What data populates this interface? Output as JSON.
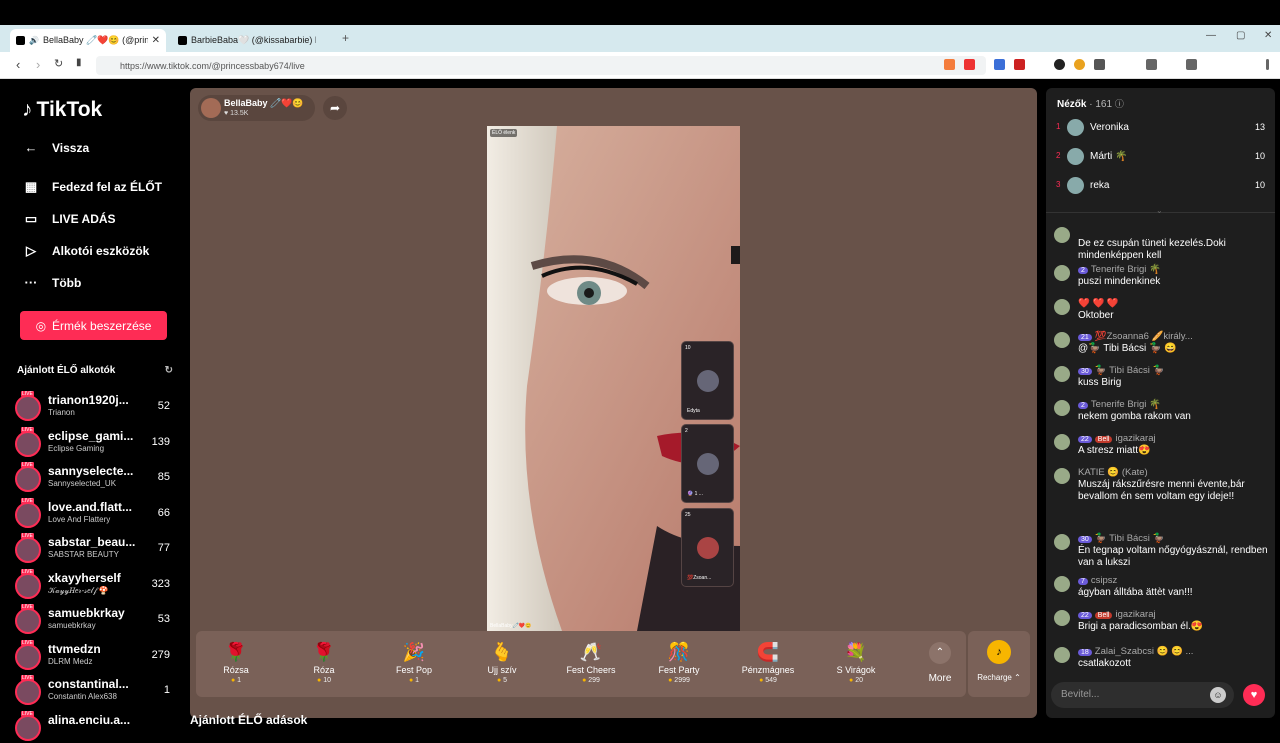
{
  "browser": {
    "tabs": [
      {
        "label": "BellaBaby 🧷❤️😊 (@princ"
      },
      {
        "label": "BarbieBaba🤍 (@kissabarbie) ÉLŐ ad"
      }
    ],
    "url": "https://www.tiktok.com/@princessbaby674/live"
  },
  "sidebar": {
    "logo": "TikTok",
    "nav": [
      {
        "label": "Vissza",
        "icon": "arrow-left"
      },
      {
        "label": "Fedezd fel az ÉLŐT",
        "icon": "calendar"
      },
      {
        "label": "LIVE ADÁS",
        "icon": "video-camera"
      },
      {
        "label": "Alkotói eszközök",
        "icon": "play-bubble"
      },
      {
        "label": "Több",
        "icon": "more"
      }
    ],
    "coins_button": "Érmék beszerzése",
    "suggested_header": "Ajánlott ÉLŐ alkotók",
    "suggested": [
      {
        "name": "trianon1920j...",
        "sub": "Trianon",
        "count": "52"
      },
      {
        "name": "eclipse_gami...",
        "sub": "Eclipse Gaming",
        "count": "139"
      },
      {
        "name": "sannyselecte...",
        "sub": "Sannyselected_UK",
        "count": "85"
      },
      {
        "name": "love.and.flatt...",
        "sub": "Love And Flattery",
        "count": "66"
      },
      {
        "name": "sabstar_beau...",
        "sub": "SABSTAR BEAUTY",
        "count": "77"
      },
      {
        "name": "xkayyherself",
        "sub": "𝒦𝒶𝓎𝓎𝐻𝑒𝓇-𝓈𝑒𝓁𝒻 🍄",
        "count": "323"
      },
      {
        "name": "samuebkrkay",
        "sub": "samuebkrkay",
        "count": "53"
      },
      {
        "name": "ttvmedzn",
        "sub": "DLRM Medz",
        "count": "279"
      },
      {
        "name": "constantinal...",
        "sub": "Constantin Alex638",
        "count": "1"
      },
      {
        "name": "alina.enciu.a...",
        "sub": "",
        "count": ""
      }
    ],
    "live_tag": "LIVE"
  },
  "stream": {
    "host_name": "BellaBaby 🧷❤️😊",
    "host_likes": "♥ 13.5K",
    "live_tag": "ÉLŐ élenk",
    "video_host_tag": "BellaBaby🧷❤️😊",
    "guests": [
      {
        "count": "10",
        "name": "Edyta"
      },
      {
        "count": "2",
        "name": "🔮 1 ..."
      },
      {
        "count": "25",
        "name": "💯Zsoan..."
      }
    ]
  },
  "gifts": [
    {
      "name": "Rózsa",
      "price": "1",
      "icon": "🌹"
    },
    {
      "name": "Róza",
      "price": "10",
      "icon": "🌹"
    },
    {
      "name": "Fest Pop",
      "price": "1",
      "icon": "🎉"
    },
    {
      "name": "Ujj szív",
      "price": "5",
      "icon": "🫰"
    },
    {
      "name": "Fest Cheers",
      "price": "299",
      "icon": "🥂"
    },
    {
      "name": "Fest Party",
      "price": "2999",
      "icon": "🎊"
    },
    {
      "name": "Pénzmágnes",
      "price": "549",
      "icon": "🧲"
    },
    {
      "name": "S Virágok",
      "price": "20",
      "icon": "💐"
    }
  ],
  "more_label": "More",
  "recharge_label": "Recharge ⌃",
  "below_title": "Ajánlott ÉLŐ adások",
  "viewers": {
    "title": "Nézők",
    "count": "· 161",
    "top": [
      {
        "rank": "1",
        "name": "Veronika",
        "score": "13"
      },
      {
        "rank": "2",
        "name": "Márti 🌴",
        "score": "10"
      },
      {
        "rank": "3",
        "name": "reka",
        "score": "10"
      }
    ]
  },
  "chat": [
    {
      "badge": "",
      "badge2": "",
      "user": "",
      "text": "De ez csupán tüneti kezelés.Doki mindenképpen kell"
    },
    {
      "badge": "2",
      "badge2": "",
      "user": "Tenerife Brigi 🌴",
      "text": "puszi mindenkinek"
    },
    {
      "badge": "",
      "badge2": "",
      "user": "❤️ ❤️ ❤️",
      "text": "Oktober"
    },
    {
      "badge": "21",
      "badge2": "",
      "user": "💯Zsoanna6 🥖király...",
      "text": "@🦆 Tibi Bácsi 🦆 😄"
    },
    {
      "badge": "30",
      "badge2": "",
      "user": "🦆 Tibi Bácsi 🦆",
      "text": "kuss Birig"
    },
    {
      "badge": "2",
      "badge2": "",
      "user": "Tenerife Brigi 🌴",
      "text": "nekem gomba rakom van"
    },
    {
      "badge": "22",
      "badge2": "Bell",
      "user": "igazikaraj",
      "text": "A stresz miatt😍"
    },
    {
      "badge": "",
      "badge2": "",
      "user": "KATIE 😊 (Kate)",
      "text": "Muszáj rákszűrésre menni évente,bár bevallom én sem voltam egy ideje!!"
    },
    {
      "badge": "30",
      "badge2": "",
      "user": "🦆 Tibi Bácsi 🦆",
      "text": "Én tegnap voltam nőgyógyásznál, rendben van a lukszi"
    },
    {
      "badge": "7",
      "badge2": "",
      "user": "csipsz",
      "text": "ágyban álltába ättèt van!!!"
    },
    {
      "badge": "22",
      "badge2": "Bell",
      "user": "igazikaraj",
      "text": "Brigi a paradicsomban él.😍"
    },
    {
      "badge": "18",
      "badge2": "",
      "user": "Zalai_Szabcsi 😊 😊 ...",
      "text": "csatlakozott"
    }
  ],
  "input_placeholder": "Bevitel..."
}
